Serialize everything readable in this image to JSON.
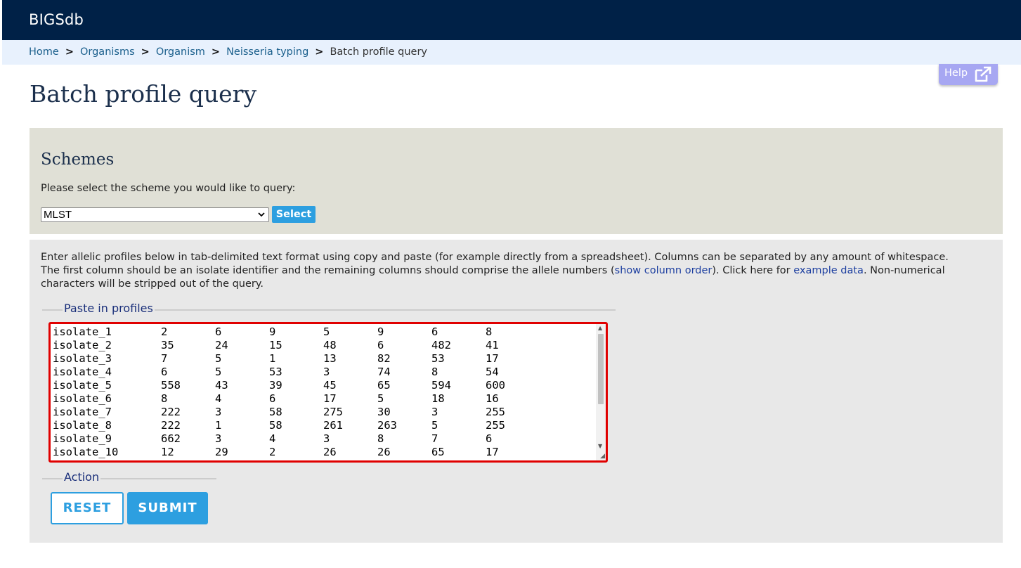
{
  "header": {
    "brand": "BIGSdb"
  },
  "breadcrumb": {
    "items": [
      {
        "label": "Home"
      },
      {
        "label": "Organisms"
      },
      {
        "label": "Organism"
      },
      {
        "label": "Neisseria typing"
      }
    ],
    "separator": ">",
    "current": "Batch profile query"
  },
  "help": {
    "label": "Help",
    "icon": "external-link-icon"
  },
  "page": {
    "title": "Batch profile query"
  },
  "schemes": {
    "heading": "Schemes",
    "prompt": "Please select the scheme you would like to query:",
    "selected": "MLST",
    "select_button": "Select"
  },
  "intro": {
    "part1": "Enter allelic profiles below in tab-delimited text format using copy and paste (for example directly from a spreadsheet). Columns can be separated by any amount of whitespace. The first column should be an isolate identifier and the remaining columns should comprise the allele numbers (",
    "link1": "show column order",
    "part2": "). Click here for ",
    "link2": "example data",
    "part3": ". Non-numerical characters will be stripped out of the query."
  },
  "paste_fieldset": {
    "legend": "Paste in profiles"
  },
  "profiles": [
    [
      "isolate_1",
      "2",
      "6",
      "9",
      "5",
      "9",
      "6",
      "8"
    ],
    [
      "isolate_2",
      "35",
      "24",
      "15",
      "48",
      "6",
      "482",
      "41"
    ],
    [
      "isolate_3",
      "7",
      "5",
      "1",
      "13",
      "82",
      "53",
      "17"
    ],
    [
      "isolate_4",
      "6",
      "5",
      "53",
      "3",
      "74",
      "8",
      "54"
    ],
    [
      "isolate_5",
      "558",
      "43",
      "39",
      "45",
      "65",
      "594",
      "600"
    ],
    [
      "isolate_6",
      "8",
      "4",
      "6",
      "17",
      "5",
      "18",
      "16"
    ],
    [
      "isolate_7",
      "222",
      "3",
      "58",
      "275",
      "30",
      "3",
      "255"
    ],
    [
      "isolate_8",
      "222",
      "1",
      "58",
      "261",
      "263",
      "5",
      "255"
    ],
    [
      "isolate_9",
      "662",
      "3",
      "4",
      "3",
      "8",
      "7",
      "6"
    ],
    [
      "isolate_10",
      "12",
      "29",
      "2",
      "26",
      "26",
      "65",
      "17"
    ]
  ],
  "action_fieldset": {
    "legend": "Action"
  },
  "actions": {
    "reset": "RESET",
    "submit": "SUBMIT"
  },
  "colors": {
    "header_bg": "#002147",
    "accent": "#2d9fe0",
    "highlight_border": "#e00000"
  }
}
